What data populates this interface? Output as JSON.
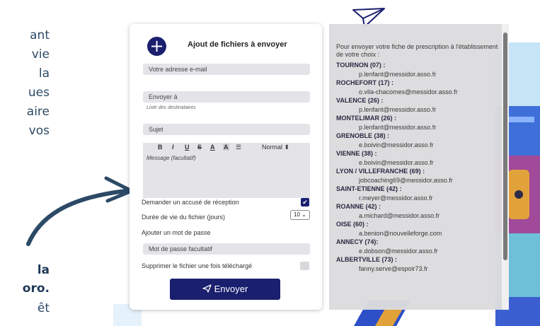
{
  "left_text": {
    "lines": [
      "ant",
      "vie",
      "la",
      "ues",
      "aire",
      "vos"
    ],
    "bold_lines": [
      "la",
      "oro.",
      "êt"
    ]
  },
  "form": {
    "title": "Ajout de fichiers à envoyer",
    "plus_icon": "+",
    "email_placeholder": "Votre adresse e-mail",
    "recipient_placeholder": "Envoyer à",
    "recipient_hint": "Liste des destinataires",
    "subject_placeholder": "Sujet",
    "toolbar": {
      "bold": "B",
      "italic": "I",
      "underline": "U",
      "strike": "S",
      "text_color": "A",
      "highlight": "A",
      "list": "☰",
      "style_select": "Normal ⬍"
    },
    "message_placeholder": "Message (facultatif)",
    "receipt_label": "Demander un accusé de réception",
    "receipt_checked": true,
    "lifetime_label": "Durée de vie du fichier (jours)",
    "lifetime_value": "10",
    "password_toggle_label": "Ajouter un mot de passe",
    "password_placeholder": "Mot de passe facultatif",
    "delete_label": "Supprimer le fichier une fois téléchargé",
    "delete_checked": false,
    "send_label": "Envoyer",
    "send_icon": "send-icon"
  },
  "panel": {
    "intro": "Pour envoyer votre fiche de prescription à l'établissement de votre choix :",
    "entries": [
      {
        "city": "TOURNON (07) :",
        "email": "p.lenfant@messidor.asso.fr"
      },
      {
        "city": "ROCHEFORT (17) :",
        "email": "o.vila-chacomes@messidor.asso.fr"
      },
      {
        "city": "VALENCE (26) :",
        "email": "p.lenfant@messidor.asso.fr"
      },
      {
        "city": "MONTELIMAR (26) :",
        "email": "p.lenfant@messidor.asso.fr"
      },
      {
        "city": "GRENOBLE (38) :",
        "email": "e.boivin@messidor.asso.fr"
      },
      {
        "city": "VIENNE (38) :",
        "email": "e.boivin@messidor.asso.fr"
      },
      {
        "city": "LYON / VILLEFRANCHE (69) :",
        "email": "jobcoaching69@messidor.asso.fr"
      },
      {
        "city": "SAINT-ETIENNE (42) :",
        "email": "r.meyer@messidor.asso.fr"
      },
      {
        "city": "ROANNE (42) :",
        "email": "a.michard@messidor.asso.fr"
      },
      {
        "city": "OISE (60) :",
        "email": "a.benion@nouvelleforge.com"
      },
      {
        "city": "ANNECY (74):",
        "email": "e.dobson@messidor.asso.fr"
      },
      {
        "city": "ALBERTVILLE (73) :",
        "email": "fanny.serve@espoir73.fr"
      }
    ]
  },
  "colors": {
    "primary": "#1a1f6e",
    "field_bg": "#e4e4e8",
    "panel_bg": "#dcdcde",
    "left_text": "#2c4a66"
  }
}
